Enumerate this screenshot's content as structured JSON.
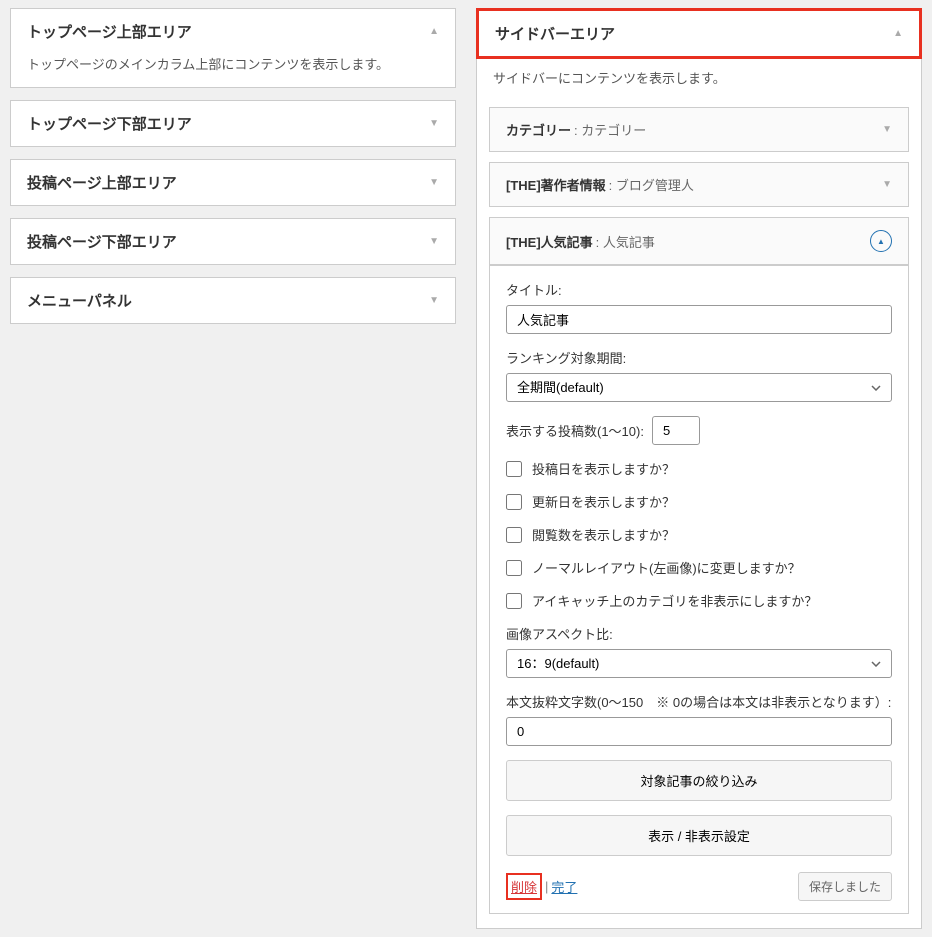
{
  "left": {
    "panels": [
      {
        "title": "トップページ上部エリア",
        "desc": "トップページのメインカラム上部にコンテンツを表示します。",
        "expanded": true
      },
      {
        "title": "トップページ下部エリア"
      },
      {
        "title": "投稿ページ上部エリア"
      },
      {
        "title": "投稿ページ下部エリア"
      },
      {
        "title": "メニューパネル"
      }
    ]
  },
  "right": {
    "title": "サイドバーエリア",
    "desc": "サイドバーにコンテンツを表示します。",
    "widgets": {
      "category": {
        "name": "カテゴリー",
        "suffix": ": カテゴリー"
      },
      "author": {
        "name": "[THE]著作者情報",
        "suffix": ": ブログ管理人"
      },
      "popular": {
        "name": "[THE]人気記事",
        "suffix": ": 人気記事",
        "form": {
          "title_label": "タイトル:",
          "title_value": "人気記事",
          "period_label": "ランキング対象期間:",
          "period_value": "全期間(default)",
          "count_label": "表示する投稿数(1～10):",
          "count_value": "5",
          "cb1": "投稿日を表示しますか？",
          "cb2": "更新日を表示しますか？",
          "cb3": "閲覧数を表示しますか？",
          "cb4": "ノーマルレイアウト(左画像)に変更しますか？",
          "cb5": "アイキャッチ上のカテゴリを非表示にしますか？",
          "aspect_label": "画像アスペクト比:",
          "aspect_value": "16：9(default)",
          "excerpt_label": "本文抜粋文字数(0～150　※ 0の場合は本文は非表示となります）:",
          "excerpt_value": "0",
          "btn_filter": "対象記事の絞り込み",
          "btn_visibility": "表示 / 非表示設定",
          "link_delete": "削除",
          "link_done": "完了",
          "sep": "|",
          "saved": "保存しました"
        }
      }
    }
  }
}
